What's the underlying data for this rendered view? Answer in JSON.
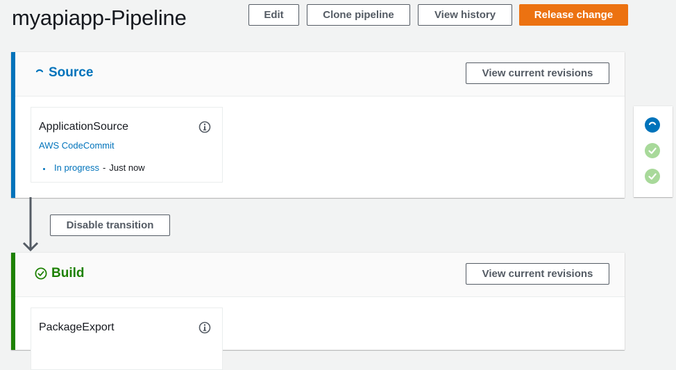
{
  "header": {
    "title": "myapiapp-Pipeline",
    "buttons": {
      "edit": "Edit",
      "clone": "Clone pipeline",
      "history": "View history",
      "release": "Release change"
    }
  },
  "stages": [
    {
      "name": "Source",
      "state": "in-progress",
      "accent_color": "#0073bb",
      "revisions_button": "View current revisions",
      "action": {
        "name": "ApplicationSource",
        "provider": "AWS CodeCommit",
        "status": "In progress",
        "separator": "-",
        "time": "Just now"
      }
    },
    {
      "name": "Build",
      "state": "succeeded",
      "accent_color": "#1d8102",
      "revisions_button": "View current revisions",
      "action": {
        "name": "PackageExport"
      }
    }
  ],
  "transition": {
    "button": "Disable transition"
  },
  "stage_overview": [
    {
      "state": "in-progress",
      "icon": "spinner-icon"
    },
    {
      "state": "succeeded",
      "icon": "check-circle-icon"
    },
    {
      "state": "succeeded",
      "icon": "check-circle-icon"
    }
  ],
  "colors": {
    "primary": "#ec7211",
    "link": "#0073bb",
    "success": "#1d8102",
    "success_light": "#a8d99a"
  }
}
